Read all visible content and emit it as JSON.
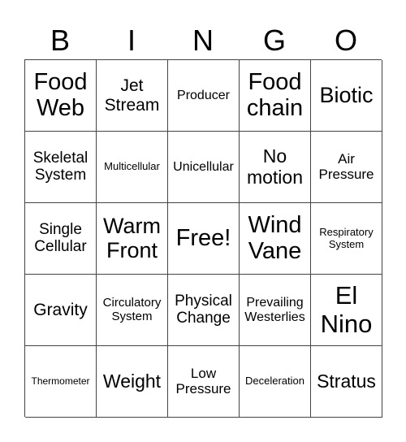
{
  "header": [
    "B",
    "I",
    "N",
    "G",
    "O"
  ],
  "cells": [
    "Food Web",
    "Jet Stream",
    "Producer",
    "Food chain",
    "Biotic",
    "Skeletal System",
    "Multicellular",
    "Unicellular",
    "No motion",
    "Air Pressure",
    "Single Cellular",
    "Warm Front",
    "Free!",
    "Wind Vane",
    "Respiratory System",
    "Gravity",
    "Circulatory System",
    "Physical Change",
    "Prevailing Westerlies",
    "El Nino",
    "Thermometer",
    "Weight",
    "Low Pressure",
    "Deceleration",
    "Stratus"
  ]
}
